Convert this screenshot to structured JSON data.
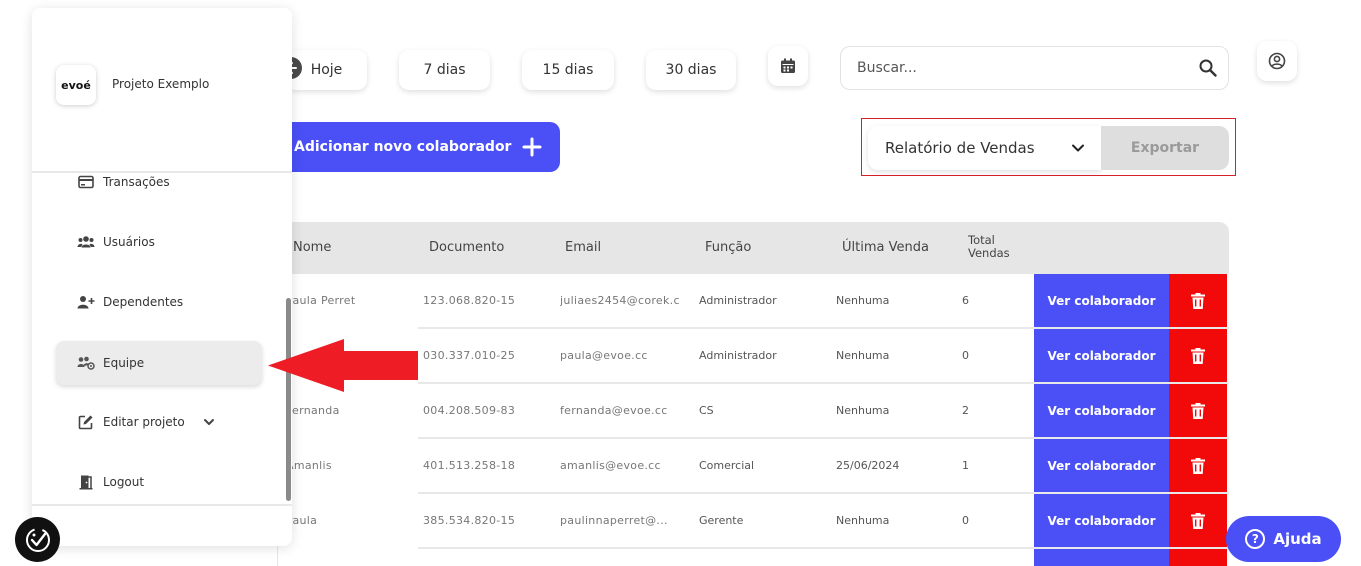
{
  "filters": {
    "today": "Hoje",
    "d7": "7 dias",
    "d15": "15 dias",
    "d30": "30 dias"
  },
  "search": {
    "placeholder": "Buscar..."
  },
  "actions": {
    "add_label": "Adicionar novo colaborador",
    "report_select": "Relatório de Vendas",
    "export_label": "Exportar"
  },
  "table": {
    "headers": {
      "name": "Nome",
      "document": "Documento",
      "email": "Email",
      "role": "Função",
      "last_sale": "Última Venda",
      "total_line1": "Total",
      "total_line2": "Vendas"
    },
    "view_label": "Ver colaborador",
    "rows": [
      {
        "name": "Paula Perret",
        "document": "123.068.820-15",
        "email": "juliaes2454@corek.com",
        "role": "Administrador",
        "last_sale": "Nenhuma",
        "total": "6"
      },
      {
        "name": "",
        "document": "030.337.010-25",
        "email": "paula@evoe.cc",
        "role": "Administrador",
        "last_sale": "Nenhuma",
        "total": "0"
      },
      {
        "name": "Fernanda",
        "document": "004.208.509-83",
        "email": "fernanda@evoe.cc",
        "role": "CS",
        "last_sale": "Nenhuma",
        "total": "2"
      },
      {
        "name": "Amanlis",
        "document": "401.513.258-18",
        "email": "amanlis@evoe.cc",
        "role": "Comercial",
        "last_sale": "25/06/2024",
        "total": "1"
      },
      {
        "name": "Paula",
        "document": "385.534.820-15",
        "email": "paulinnaperret@...",
        "role": "Gerente",
        "last_sale": "Nenhuma",
        "total": "0"
      }
    ]
  },
  "sidebar": {
    "logo_text": "evoé",
    "project_name": "Projeto Exemplo",
    "items": [
      {
        "label": "Transações",
        "icon": "card-icon"
      },
      {
        "label": "Usuários",
        "icon": "users-icon"
      },
      {
        "label": "Dependentes",
        "icon": "user-plus-icon"
      },
      {
        "label": "Equipe",
        "icon": "team-icon"
      },
      {
        "label": "Editar projeto",
        "icon": "edit-icon"
      },
      {
        "label": "Logout",
        "icon": "door-icon"
      }
    ]
  },
  "help": {
    "label": "Ajuda",
    "q": "?"
  },
  "colors": {
    "primary": "#4a4ff6",
    "danger": "#f20a0a",
    "annotation": "#d6202a",
    "export_disabled": "#dedede"
  }
}
